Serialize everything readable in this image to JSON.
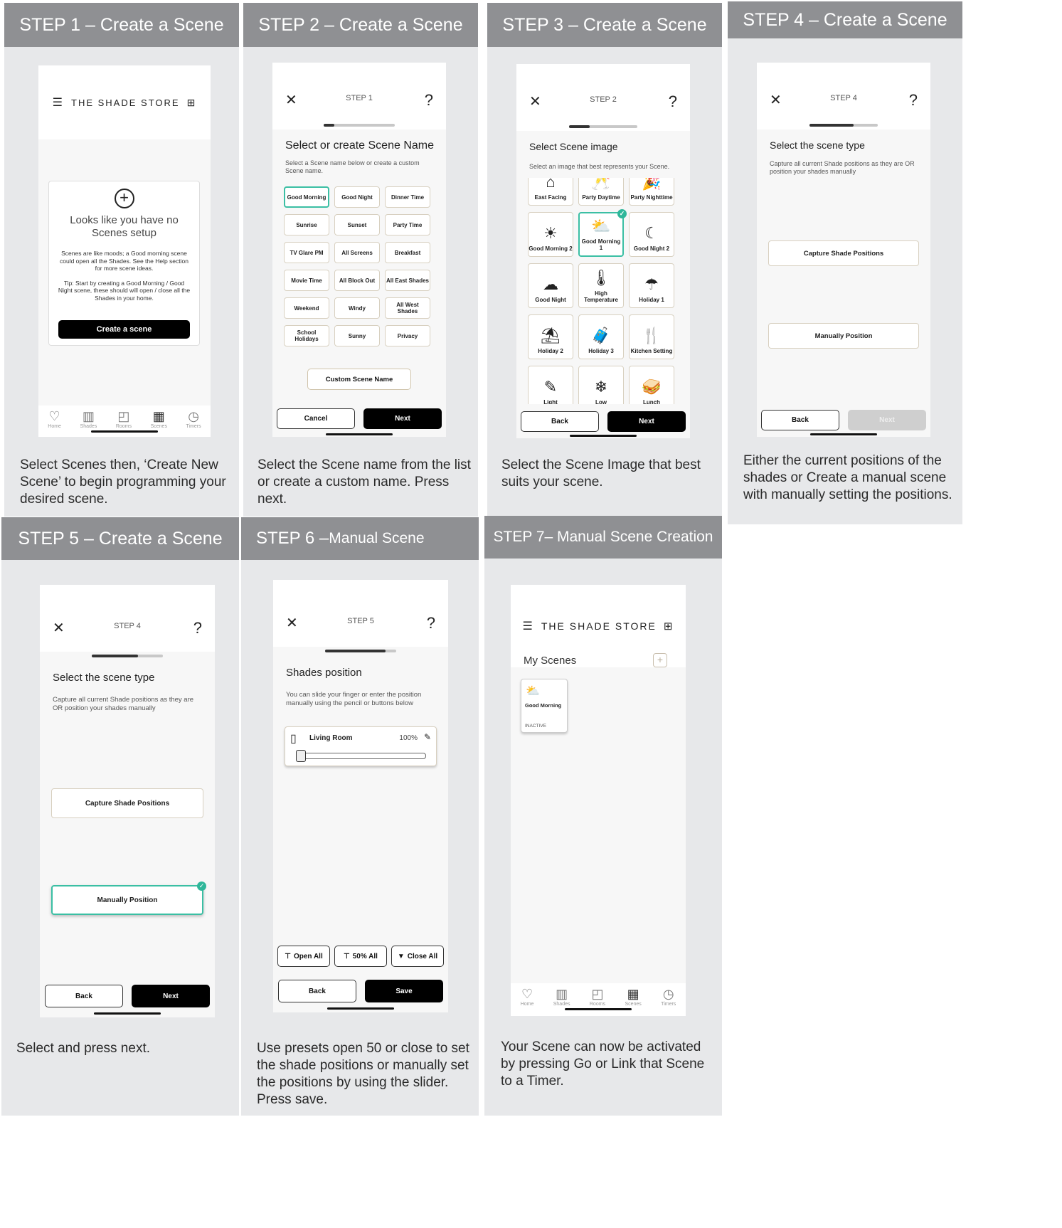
{
  "brand": {
    "name": "THE SHADE STORE",
    "trademark": "®"
  },
  "tabs": [
    {
      "icon": "heart-icon",
      "glyph": "♡",
      "label": "Home"
    },
    {
      "icon": "shade-icon",
      "glyph": "▥",
      "label": "Shades"
    },
    {
      "icon": "room-icon",
      "glyph": "◰",
      "label": "Rooms"
    },
    {
      "icon": "scenes-icon",
      "glyph": "▦",
      "label": "Scenes"
    },
    {
      "icon": "timer-icon",
      "glyph": "◷",
      "label": "Timers"
    }
  ],
  "colors": {
    "header": "#8f9093",
    "panel": "#e7e8ea",
    "accent": "#3bbfa4"
  },
  "panels": [
    {
      "header": "STEP 1 – Create a Scene",
      "desc": "Select Scenes then, ‘Create New Scene’ to begin programming your desired scene.",
      "empty_title": "Looks like you have no Scenes setup",
      "empty_text": "Scenes are like moods; a Good morning scene could open all the Shades. See the Help section for more scene ideas.",
      "tip": "Tip: Start by creating a Good Morning / Good Night scene, these should will open / close all the Shades in your home.",
      "create_btn": "Create a scene",
      "add_icon": "plus-circle-icon"
    },
    {
      "header": "STEP 2 – Create a Scene",
      "desc": "Select the Scene name from the list or create a custom name. Press next.",
      "step": "STEP 1",
      "title": "Select or create Scene Name",
      "sub": "Select a Scene name below or create a custom Scene name.",
      "names": [
        "Good Morning",
        "Good Night",
        "Dinner Time",
        "Sunrise",
        "Sunset",
        "Party Time",
        "TV Glare PM",
        "All Screens",
        "Breakfast",
        "Movie Time",
        "All Block Out",
        "All East Shades",
        "Weekend",
        "Windy",
        "All West Shades",
        "School Holidays",
        "Sunny",
        "Privacy"
      ],
      "custom_btn": "Custom Scene Name",
      "cancel": "Cancel",
      "next": "Next",
      "progress": 0.15
    },
    {
      "header": "STEP 3 – Create a Scene",
      "desc": "Select the Scene Image that best suits your scene.",
      "step": "STEP 2",
      "title": "Select Scene image",
      "sub": "Select an image that best represents your Scene.",
      "images": [
        {
          "label": "East Facing",
          "glyph": "⌂",
          "icon": "east-facing-icon"
        },
        {
          "label": "Party Daytime",
          "glyph": "🥂",
          "icon": "party-daytime-icon"
        },
        {
          "label": "Party Nighttime",
          "glyph": "🎉",
          "icon": "party-nighttime-icon"
        },
        {
          "label": "Good Morning 2",
          "glyph": "☀",
          "icon": "sunrise-icon"
        },
        {
          "label": "Good Morning 1",
          "glyph": "⛅",
          "icon": "cloud-sun-icon"
        },
        {
          "label": "Good Night 2",
          "glyph": "☾",
          "icon": "moon-icon"
        },
        {
          "label": "Good Night",
          "glyph": "☁",
          "icon": "cloud-moon-icon"
        },
        {
          "label": "High Temperature",
          "glyph": "🌡",
          "icon": "thermometer-hot-icon"
        },
        {
          "label": "Holiday 1",
          "glyph": "☂",
          "icon": "umbrella-icon"
        },
        {
          "label": "Holiday 2",
          "glyph": "⛱",
          "icon": "patio-icon"
        },
        {
          "label": "Holiday 3",
          "glyph": "🧳",
          "icon": "luggage-icon"
        },
        {
          "label": "Kitchen Setting",
          "glyph": "🍴",
          "icon": "utensils-icon"
        },
        {
          "label": "Light",
          "glyph": "✎",
          "icon": "light-icon"
        },
        {
          "label": "Low",
          "glyph": "❄",
          "icon": "thermometer-cold-icon"
        },
        {
          "label": "Lunch",
          "glyph": "🥪",
          "icon": "sandwich-icon"
        }
      ],
      "back": "Back",
      "next": "Next",
      "progress": 0.3
    },
    {
      "header": "STEP 4 – Create a Scene",
      "desc": "Either the current positions of the shades or Create a manual scene with manually setting the positions.",
      "step": "STEP 4",
      "title": "Select the scene type",
      "sub": "Capture all current Shade positions as they are OR position your shades manually",
      "capture": "Capture Shade Positions",
      "manual": "Manually Position",
      "back": "Back",
      "next": "Next",
      "progress": 0.65
    },
    {
      "header": "STEP 5 – Create a Scene",
      "desc": "Select and press next.",
      "step": "STEP 4",
      "title": "Select the scene type",
      "sub": "Capture all current Shade positions as they are OR position your shades manually",
      "capture": "Capture Shade Positions",
      "manual": "Manually Position",
      "back": "Back",
      "next": "Next",
      "progress": 0.65
    },
    {
      "header_a": "STEP 6 – ",
      "header_b": "Manual Scene",
      "desc": "Use presets open 50 or close to set the shade positions or manually set the positions by using the slider. Press save.",
      "step": "STEP 5",
      "title": "Shades position",
      "sub": "You can slide your finger or enter the position manually using the pencil or buttons below",
      "room": "Living Room",
      "percent": "100%",
      "slider_value": 0,
      "open_all": "Open All",
      "half_all": "50% All",
      "close_all": "Close All",
      "back": "Back",
      "save": "Save",
      "progress": 0.85
    },
    {
      "header": "STEP 7– Manual Scene Creation",
      "desc": "Your Scene can now be activated by pressing Go or Link that Scene to a Timer.",
      "my_scenes": "My Scenes",
      "scene_name": "Good Morning",
      "scene_status": "INACTIVE"
    }
  ]
}
